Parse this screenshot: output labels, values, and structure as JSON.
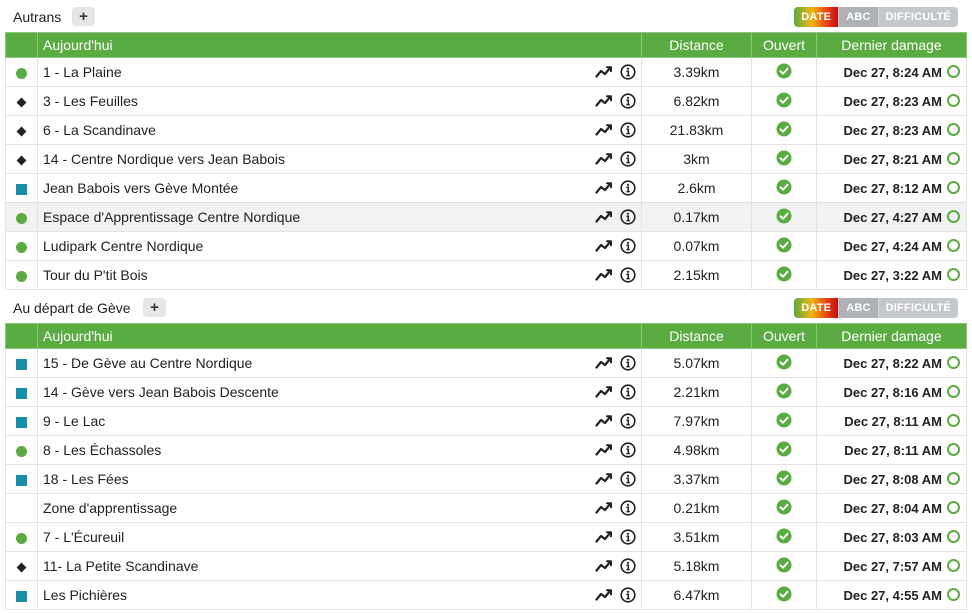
{
  "sort_buttons": {
    "date": "DATE",
    "abc": "ABC",
    "difficulty": "DIFFICULTÉ"
  },
  "columns": {
    "today": "Aujourd'hui",
    "distance": "Distance",
    "open": "Ouvert",
    "last_groomed": "Dernier damage"
  },
  "colors": {
    "header_green": "#5aab41",
    "easy": "#5aab41",
    "intermediate": "#178fa6",
    "difficult": "#222222"
  },
  "sections": [
    {
      "title": "Autrans",
      "add_label": "+",
      "trails": [
        {
          "indicator": "circle",
          "name": "1 - La Plaine",
          "distance": "3.39km",
          "groomed": "Dec 27, 8:24 AM"
        },
        {
          "indicator": "diamond",
          "name": "3 - Les Feuilles",
          "distance": "6.82km",
          "groomed": "Dec 27, 8:23 AM"
        },
        {
          "indicator": "diamond",
          "name": "6 - La Scandinave",
          "distance": "21.83km",
          "groomed": "Dec 27, 8:23 AM"
        },
        {
          "indicator": "diamond",
          "name": "14 - Centre Nordique vers Jean Babois",
          "distance": "3km",
          "groomed": "Dec 27, 8:21 AM"
        },
        {
          "indicator": "square",
          "name": "Jean Babois vers Gève Montée",
          "distance": "2.6km",
          "groomed": "Dec 27, 8:12 AM"
        },
        {
          "indicator": "circle",
          "name": "Espace d'Apprentissage Centre Nordique",
          "distance": "0.17km",
          "groomed": "Dec 27, 4:27 AM",
          "highlight": true
        },
        {
          "indicator": "circle",
          "name": "Ludipark Centre Nordique",
          "distance": "0.07km",
          "groomed": "Dec 27, 4:24 AM"
        },
        {
          "indicator": "circle",
          "name": "Tour du P'tit Bois",
          "distance": "2.15km",
          "groomed": "Dec 27, 3:22 AM"
        }
      ]
    },
    {
      "title": "Au départ de Gève",
      "add_label": "+",
      "trails": [
        {
          "indicator": "square",
          "name": "15 - De Gève au Centre Nordique",
          "distance": "5.07km",
          "groomed": "Dec 27, 8:22 AM"
        },
        {
          "indicator": "square",
          "name": "14 - Gève vers Jean Babois Descente",
          "distance": "2.21km",
          "groomed": "Dec 27, 8:16 AM"
        },
        {
          "indicator": "square",
          "name": "9 - Le Lac",
          "distance": "7.97km",
          "groomed": "Dec 27, 8:11 AM"
        },
        {
          "indicator": "circle",
          "name": "8 - Les Échassoles",
          "distance": "4.98km",
          "groomed": "Dec 27, 8:11 AM"
        },
        {
          "indicator": "square",
          "name": "18 - Les Fées",
          "distance": "3.37km",
          "groomed": "Dec 27, 8:08 AM"
        },
        {
          "indicator": "none",
          "name": "Zone d'apprentissage",
          "distance": "0.21km",
          "groomed": "Dec 27, 8:04 AM"
        },
        {
          "indicator": "circle",
          "name": "7 - L'Écureuil",
          "distance": "3.51km",
          "groomed": "Dec 27, 8:03 AM"
        },
        {
          "indicator": "diamond",
          "name": "11- La Petite Scandinave",
          "distance": "5.18km",
          "groomed": "Dec 27, 7:57 AM"
        },
        {
          "indicator": "square",
          "name": "Les Pichières",
          "distance": "6.47km",
          "groomed": "Dec 27, 4:55 AM"
        }
      ]
    }
  ]
}
